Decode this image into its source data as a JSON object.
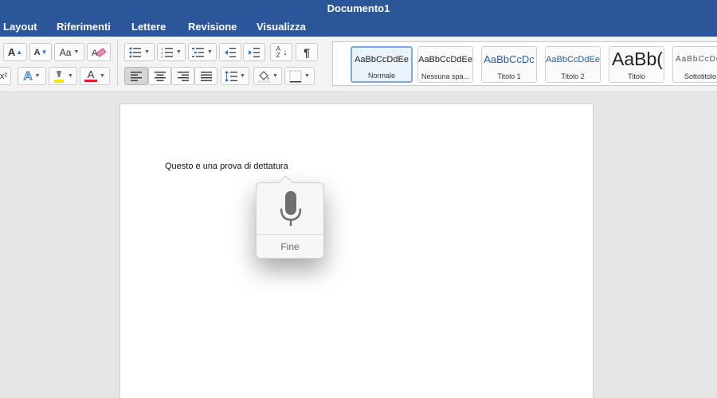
{
  "window": {
    "title": "Documento1"
  },
  "menu": {
    "tabs": [
      {
        "label": "Layout"
      },
      {
        "label": "Riferimenti"
      },
      {
        "label": "Lettere"
      },
      {
        "label": "Revisione"
      },
      {
        "label": "Visualizza"
      }
    ]
  },
  "ribbon": {
    "font": {
      "grow_label": "A",
      "shrink_label": "A",
      "change_case_label": "Aa",
      "superscript_label": "x²",
      "text_effects_label": "A",
      "font_color_label": "A",
      "font_color": "#e02020",
      "highlight_color": "#f5e400"
    },
    "paragraph": {
      "sort_label": "A Z",
      "pilcrow_label": "¶"
    },
    "styles": [
      {
        "preview": "AaBbCcDdEe",
        "name": "Normale",
        "selected": true
      },
      {
        "preview": "AaBbCcDdEe",
        "name": "Nessuna spa..."
      },
      {
        "preview": "AaBbCcDc",
        "name": "Titolo 1"
      },
      {
        "preview": "AaBbCcDdEe",
        "name": "Titolo 2"
      },
      {
        "preview": "AaBb(",
        "name": "Titolo"
      },
      {
        "preview": "AaBbCcDdEe",
        "name": "Sottotitolo"
      }
    ]
  },
  "document": {
    "body_text": "Questo e una prova di dettatura"
  },
  "dictation": {
    "icon": "microphone-icon",
    "done_label": "Fine"
  },
  "colors": {
    "titlebar": "#2b579a",
    "ribbon": "#f3f3f3",
    "canvas": "#e6e6e6",
    "page": "#ffffff"
  }
}
